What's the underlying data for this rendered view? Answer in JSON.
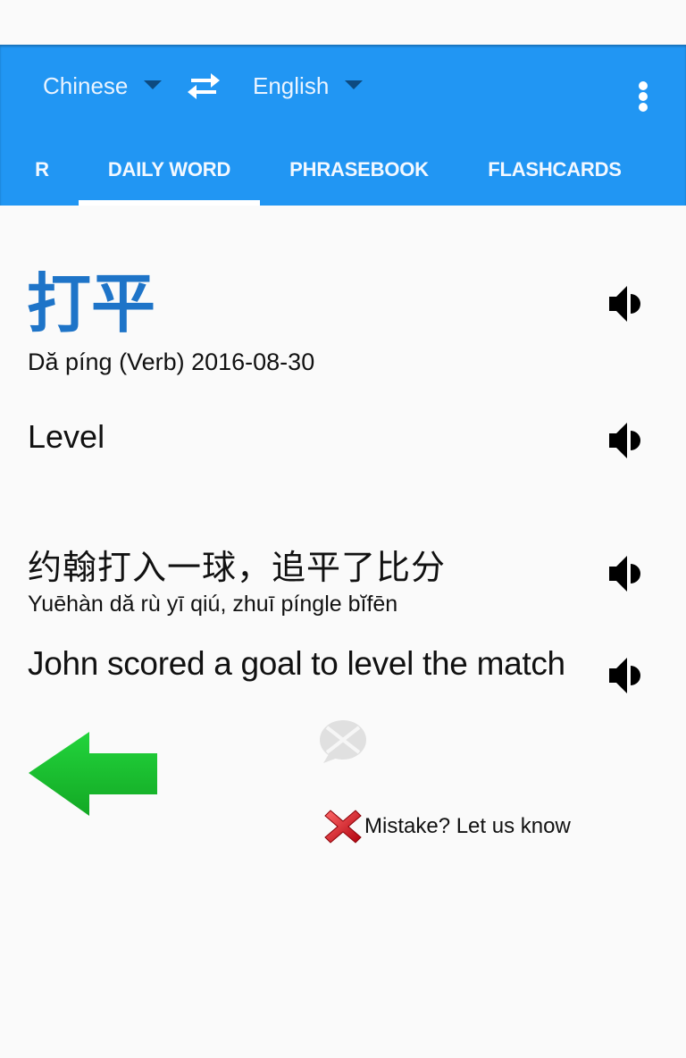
{
  "toolbar": {
    "source_language": "Chinese",
    "target_language": "English",
    "swap_icon": "swap-arrows-icon",
    "overflow_icon": "more-vertical-icon"
  },
  "tabs": [
    {
      "label": "R",
      "active": false
    },
    {
      "label": "DAILY WORD",
      "active": true
    },
    {
      "label": "PHRASEBOOK",
      "active": false
    },
    {
      "label": "FLASHCARDS",
      "active": false
    }
  ],
  "daily_word": {
    "word": "打平",
    "meta": "Dă píng (Verb) 2016-08-30",
    "translation": "Level",
    "example_chinese": "约翰打入一球，追平了比分",
    "example_pinyin": "Yuēhàn dă rù yī qiú, zhuī píngle bĭfēn",
    "example_english": "John scored a goal to level the match",
    "speaker_icon": "speaker-icon"
  },
  "actions": {
    "back_icon": "arrow-left-icon",
    "share_icon": "chat-bubble-icon",
    "mistake_icon": "red-x-icon",
    "mistake_label": "Mistake? Let us know"
  },
  "colors": {
    "primary": "#2196f3",
    "word": "#1e74c8",
    "caret": "#0d4a80",
    "back_arrow": "#1fc232",
    "mistake_x": "#d0101a"
  }
}
